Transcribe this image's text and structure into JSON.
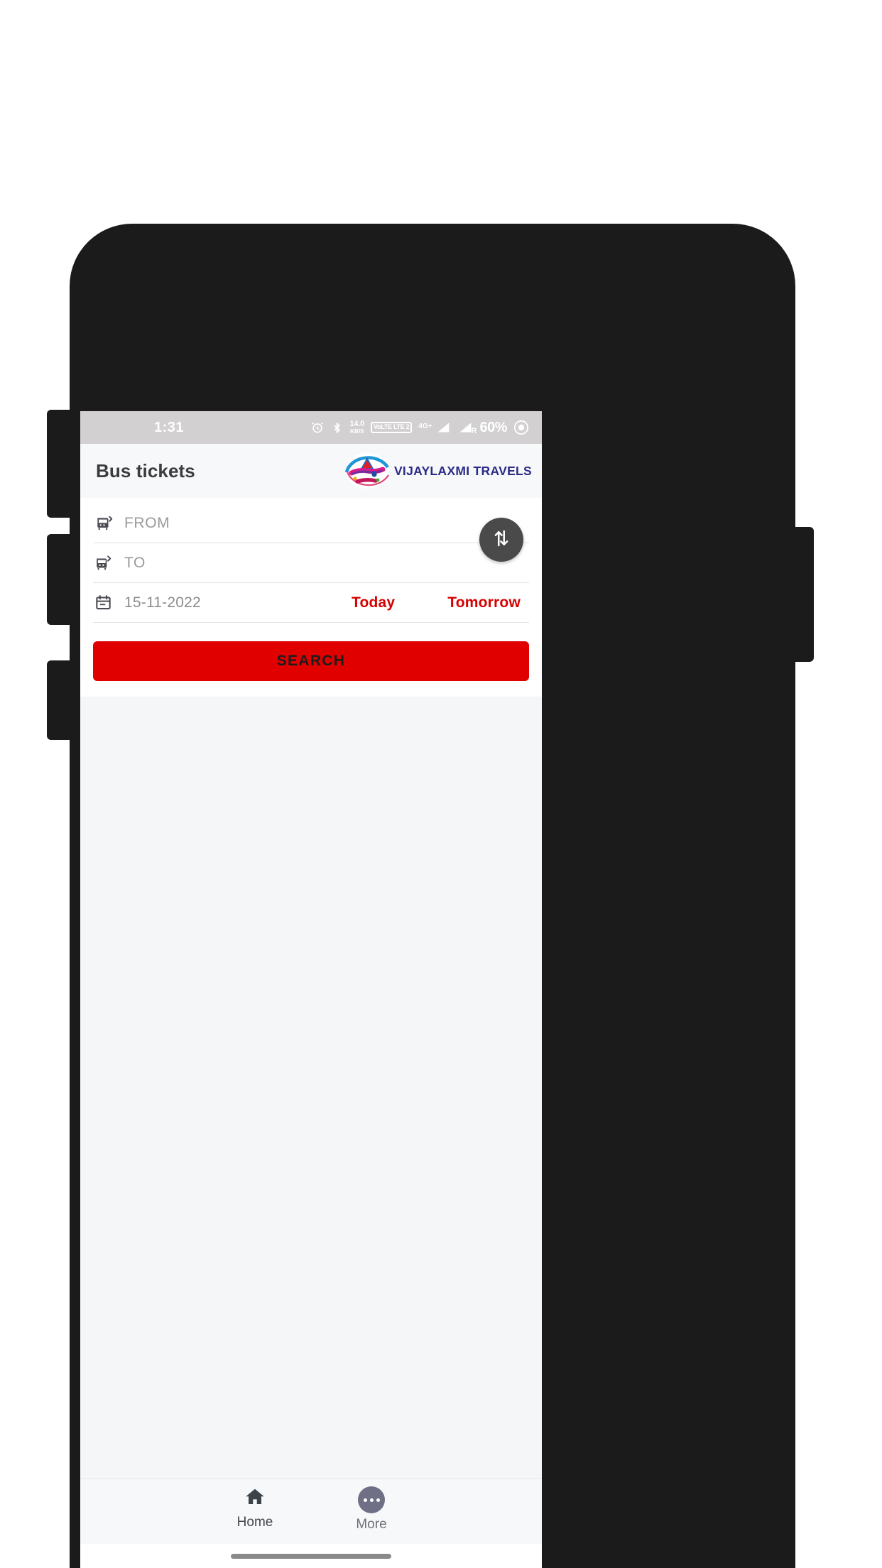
{
  "status_bar": {
    "time": "1:31",
    "alarm_icon": "alarm-clock-icon",
    "bluetooth_icon": "bluetooth-icon",
    "data_rate_value": "14.0",
    "data_rate_unit": "KB/S",
    "volte_line1": "VoLTE",
    "volte_line2": "LTE 2",
    "network_type": "4G+",
    "roaming_label": "R",
    "battery_percent": "60%",
    "background": "#d2d0d0"
  },
  "app_bar": {
    "title": "Bus tickets",
    "brand_name": "VIJAYLAXMI TRAVELS",
    "brand_color": "#2b2b86"
  },
  "search_card": {
    "from": {
      "icon": "bus-departure-icon",
      "placeholder": "FROM",
      "value": ""
    },
    "to": {
      "icon": "bus-arrival-icon",
      "placeholder": "TO",
      "value": ""
    },
    "date": {
      "icon": "calendar-icon",
      "value": "15-11-2022"
    },
    "quick_today": "Today",
    "quick_tomorrow": "Tomorrow",
    "quick_color": "#d60000",
    "swap_icon": "swap-vertical-arrows-icon",
    "search_label": "SEARCH",
    "search_button_color": "#e00000"
  },
  "bottom_nav": {
    "items": [
      {
        "label": "Home",
        "icon": "home-icon",
        "active": true
      },
      {
        "label": "More",
        "icon": "more-dots-icon",
        "active": false
      }
    ]
  }
}
